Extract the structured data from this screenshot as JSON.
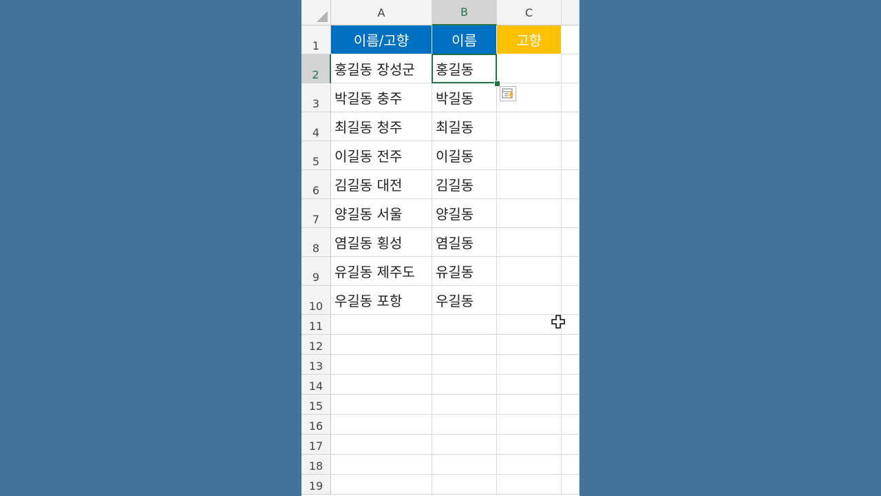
{
  "columns": [
    {
      "letter": "A",
      "selected": false
    },
    {
      "letter": "B",
      "selected": true
    },
    {
      "letter": "C",
      "selected": false
    }
  ],
  "rows": [
    "1",
    "2",
    "3",
    "4",
    "5",
    "6",
    "7",
    "8",
    "9",
    "10",
    "11",
    "12",
    "13",
    "14",
    "15",
    "16",
    "17",
    "18",
    "19"
  ],
  "selected_row": "2",
  "header": {
    "a": "이름/고향",
    "b": "이름",
    "c": "고향"
  },
  "data": [
    {
      "a": "홍길동 장성군",
      "b": "홍길동"
    },
    {
      "a": "박길동 충주",
      "b": "박길동"
    },
    {
      "a": "최길동 청주",
      "b": "최길동"
    },
    {
      "a": "이길동 전주",
      "b": "이길동"
    },
    {
      "a": "김길동 대전",
      "b": "김길동"
    },
    {
      "a": "양길동 서울",
      "b": "양길동"
    },
    {
      "a": "염길동 횡성",
      "b": "염길동"
    },
    {
      "a": "유길동 제주도",
      "b": "유길동"
    },
    {
      "a": "우길동 포항",
      "b": "우길동"
    }
  ],
  "colors": {
    "header_blue": "#0070c0",
    "header_gold": "#ffc000",
    "selection_green": "#217346"
  },
  "icons": {
    "flash_fill": "flash-fill-options-icon",
    "cursor": "cross-cursor-icon"
  }
}
